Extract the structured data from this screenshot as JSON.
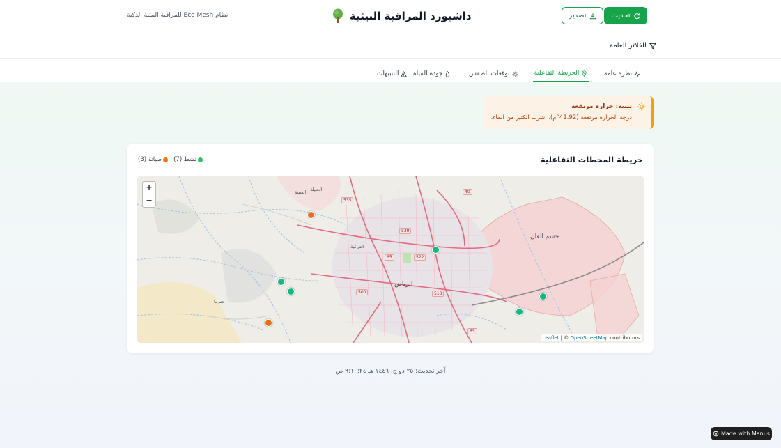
{
  "header": {
    "title": "داشبورد المراقبة البيئية",
    "subtitle": "نظام Eco Mesh للمراقبة البيئية الذكية",
    "refresh_label": "تحديث",
    "export_label": "تصدير"
  },
  "filters": {
    "label": "الفلاتر العامة"
  },
  "tabs": [
    {
      "label": "نظرة عامة",
      "icon": "activity-icon"
    },
    {
      "label": "الخريطة التفاعلية",
      "icon": "map-pin-icon",
      "active": true
    },
    {
      "label": "توقعات الطقس",
      "icon": "sun-icon"
    },
    {
      "label": "جودة المياه",
      "icon": "droplet-icon"
    },
    {
      "label": "التنبيهات",
      "icon": "alert-triangle-icon"
    }
  ],
  "alert": {
    "title": "تنبيه: حرارة مرتفعة",
    "message": "درجة الحرارة مرتفعة (41.92°م). اشرب الكثير من الماء.",
    "color": "#f59e0b"
  },
  "map_card": {
    "title": "خريطة المحطات التفاعلية",
    "legend": [
      {
        "label": "نشط (7)",
        "color": "#22c55e"
      },
      {
        "label": "صيانة (3)",
        "color": "#f97316"
      }
    ],
    "zoom_in": "+",
    "zoom_out": "−",
    "attribution": {
      "leaflet": "Leaflet",
      "sep": " | © ",
      "osm": "OpenStreetMap",
      "suffix": " contributors"
    },
    "labels": {
      "riyadh": "الرياض",
      "khashm": "خشم العان",
      "uyaynah": "العيينة",
      "diriyah": "الدرعية",
      "jubaylah": "الجبيلة",
      "muzahimiyah": "ضرما"
    },
    "roads": [
      "535",
      "539",
      "522",
      "65",
      "513",
      "500",
      "40",
      "65"
    ],
    "stations": [
      {
        "status": "maintenance",
        "color": "#ea6d1e"
      },
      {
        "status": "active",
        "color": "#10b981"
      },
      {
        "status": "active",
        "color": "#10b981"
      },
      {
        "status": "active",
        "color": "#10b981"
      },
      {
        "status": "maintenance",
        "color": "#ea6d1e"
      },
      {
        "status": "active",
        "color": "#10b981"
      },
      {
        "status": "active",
        "color": "#10b981"
      }
    ]
  },
  "footer": {
    "last_update": "آخر تحديث: ٢٥ ذو ج. ١٤٤٦ هـ ٩:١٠:٢٤ ص"
  },
  "badge": {
    "label": "Made with Manus"
  },
  "colors": {
    "accent": "#16a34a"
  }
}
